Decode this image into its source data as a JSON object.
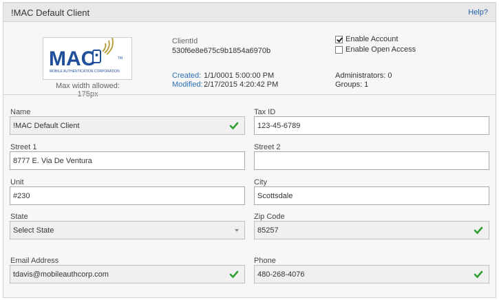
{
  "header": {
    "title": "!MAC Default Client",
    "help_link": "Help?"
  },
  "logo": {
    "letters": "MAC",
    "subtitle": "MOBILE AUTHENTICATION CORPORATION",
    "trademark": "TM",
    "max_width_note": "Max width allowed: 175px"
  },
  "client": {
    "id_label": "ClientId",
    "id_value": "530f6e8e675c9b1854a6970b",
    "created_label": "Created:",
    "created_value": "1/1/0001 5:00:00 PM",
    "modified_label": "Modified:",
    "modified_value": "2/17/2015 4:20:42 PM"
  },
  "options": {
    "enable_account": {
      "label": "Enable Account",
      "checked": true
    },
    "enable_open_access": {
      "label": "Enable Open Access",
      "checked": false
    }
  },
  "counts": {
    "administrators": "Administrators: 0",
    "groups": "Groups: 1"
  },
  "form": {
    "name": {
      "label": "Name",
      "value": "!MAC Default Client",
      "valid": true
    },
    "tax_id": {
      "label": "Tax ID",
      "value": "123-45-6789"
    },
    "street1": {
      "label": "Street 1",
      "value": "8777 E. Via De Ventura"
    },
    "street2": {
      "label": "Street 2",
      "value": ""
    },
    "unit": {
      "label": "Unit",
      "value": "#230"
    },
    "city": {
      "label": "City",
      "value": "Scottsdale"
    },
    "state": {
      "label": "State",
      "value": "Select State"
    },
    "zip": {
      "label": "Zip Code",
      "value": "85257",
      "valid": true
    },
    "email": {
      "label": "Email Address",
      "value": "tdavis@mobileauthcorp.com",
      "valid": true
    },
    "phone": {
      "label": "Phone",
      "value": "480-268-4076",
      "valid": true
    }
  },
  "colors": {
    "link_blue": "#2a6fb5",
    "valid_green": "#2e9e2e",
    "logo_blue": "#1f4e9b",
    "logo_gold": "#b8a040"
  }
}
